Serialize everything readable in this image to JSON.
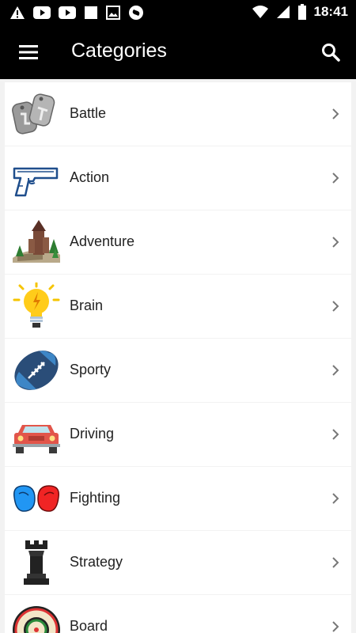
{
  "status_bar": {
    "time": "18:41",
    "left_icons": [
      "alert-icon",
      "youtube-icon",
      "youtube-icon",
      "square-icon",
      "image-icon",
      "shazam-icon"
    ],
    "right_icons": [
      "wifi-icon",
      "signal-icon",
      "battery-icon"
    ]
  },
  "toolbar": {
    "title": "Categories",
    "menu_icon": "hamburger-menu-icon",
    "search_icon": "search-icon"
  },
  "categories": [
    {
      "label": "Battle",
      "icon": "dog-tags-icon"
    },
    {
      "label": "Action",
      "icon": "pistol-icon"
    },
    {
      "label": "Adventure",
      "icon": "castle-landscape-icon"
    },
    {
      "label": "Brain",
      "icon": "lightbulb-icon"
    },
    {
      "label": "Sporty",
      "icon": "football-icon"
    },
    {
      "label": "Driving",
      "icon": "car-icon"
    },
    {
      "label": "Fighting",
      "icon": "boxing-gloves-icon"
    },
    {
      "label": "Strategy",
      "icon": "chess-rook-icon"
    },
    {
      "label": "Board",
      "icon": "dartboard-icon"
    }
  ],
  "colors": {
    "bar_background": "#000000",
    "list_background": "#f2f2f2",
    "row_background": "#ffffff",
    "chevron": "#777777"
  }
}
